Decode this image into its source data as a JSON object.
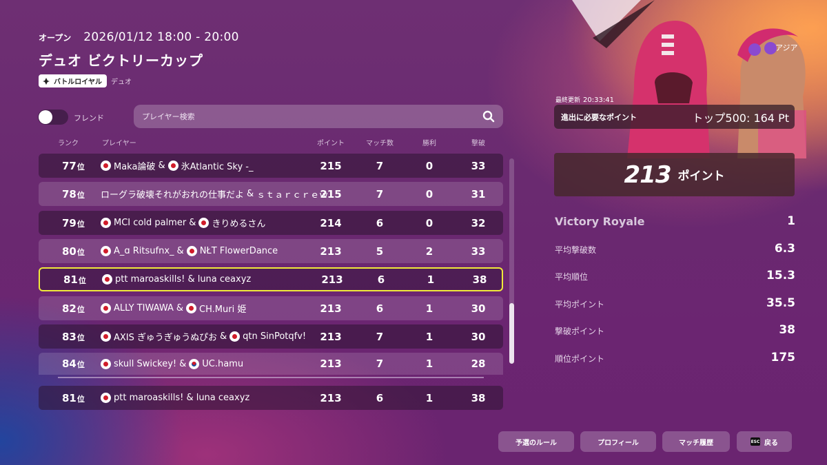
{
  "header": {
    "status": "オープン",
    "time": "2026/01/12 18:00 - 20:00",
    "title": "デュオ ビクトリーカップ",
    "mode_badge": "バトルロイヤル",
    "mode_sub": "デュオ"
  },
  "toolbar": {
    "friend_toggle_label": "フレンド",
    "friend_toggle_on": false,
    "search_placeholder": "プレイヤー検索"
  },
  "table": {
    "columns": {
      "rank": "ランク",
      "player": "プレイヤー",
      "points": "ポイント",
      "matches": "マッチ数",
      "wins": "勝利",
      "elims": "撃破"
    },
    "rows": [
      {
        "rank": "77",
        "rank_suffix": "位",
        "p1_flag": "jp",
        "p1": "Maka論破",
        "sep": "&",
        "p2_flag": "jp",
        "p2": "氷Atlantic Sky -_",
        "points": "215",
        "matches": "7",
        "wins": "0",
        "elims": "33"
      },
      {
        "rank": "78",
        "rank_suffix": "位",
        "p1_flag": "",
        "p1": "ローグラ破壊それがおれの仕事だよ",
        "sep": "&",
        "p2_flag": "",
        "p2": "ｓｔａｒｃｒｅｗ",
        "points": "215",
        "matches": "7",
        "wins": "0",
        "elims": "31"
      },
      {
        "rank": "79",
        "rank_suffix": "位",
        "p1_flag": "jp",
        "p1": "MCI cold palmer",
        "sep": "&",
        "p2_flag": "jp",
        "p2": "きりめるさん",
        "points": "214",
        "matches": "6",
        "wins": "0",
        "elims": "32"
      },
      {
        "rank": "80",
        "rank_suffix": "位",
        "p1_flag": "jp",
        "p1": "A_ɑ Ritsufnx_",
        "sep": "&",
        "p2_flag": "jp",
        "p2": "NŁT FlowerDance",
        "points": "213",
        "matches": "5",
        "wins": "2",
        "elims": "33"
      },
      {
        "rank": "81",
        "rank_suffix": "位",
        "p1_flag": "jp",
        "p1": "ptt maroaskills! & luna ceaxyz",
        "sep": "",
        "p2_flag": "",
        "p2": "",
        "points": "213",
        "matches": "6",
        "wins": "1",
        "elims": "38"
      },
      {
        "rank": "82",
        "rank_suffix": "位",
        "p1_flag": "jp",
        "p1": "ALLY TIWAWA",
        "sep": "&",
        "p2_flag": "jp",
        "p2": "CH.Muri 姫",
        "points": "213",
        "matches": "6",
        "wins": "1",
        "elims": "30"
      },
      {
        "rank": "83",
        "rank_suffix": "位",
        "p1_flag": "jp",
        "p1": "AXIS ぎゅうぎゅうぬぴお",
        "sep": "&",
        "p2_flag": "jp",
        "p2": "qtn SinPotqfv!",
        "points": "213",
        "matches": "7",
        "wins": "1",
        "elims": "30"
      },
      {
        "rank": "84",
        "rank_suffix": "位",
        "p1_flag": "jp",
        "p1": "skull Swickey!",
        "sep": "&",
        "p2_flag": "kr",
        "p2": "UC.hamu",
        "points": "213",
        "matches": "7",
        "wins": "1",
        "elims": "28"
      }
    ],
    "pinned": {
      "rank": "81",
      "rank_suffix": "位",
      "p1_flag": "jp",
      "p1": "ptt maroaskills! & luna ceaxyz",
      "points": "213",
      "matches": "6",
      "wins": "1",
      "elims": "38"
    }
  },
  "side": {
    "region": "アジア",
    "updated_label": "最終更新",
    "updated_time": "20:33:41",
    "required_label": "進出に必要なポイント",
    "required_value": "トップ500: 164 Pt",
    "points_value": "213",
    "points_unit": "ポイント",
    "stats": [
      {
        "label": "Victory Royale",
        "value": "1"
      },
      {
        "label": "平均撃破数",
        "value": "6.3"
      },
      {
        "label": "平均順位",
        "value": "15.3"
      },
      {
        "label": "平均ポイント",
        "value": "35.5"
      },
      {
        "label": "撃破ポイント",
        "value": "38"
      },
      {
        "label": "順位ポイント",
        "value": "175"
      }
    ]
  },
  "buttons": {
    "rules": "予選のルール",
    "profile": "プロフィール",
    "history": "マッチ履歴",
    "back_key": "ESC",
    "back": "戻る"
  },
  "colors": {
    "highlight": "#f0ea3a",
    "flag_red": "#d01c2a"
  }
}
